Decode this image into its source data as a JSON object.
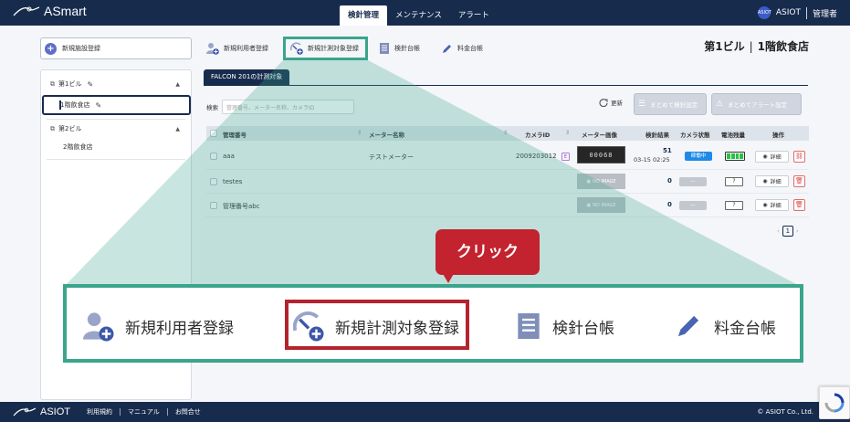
{
  "header": {
    "logo_text": "ASmart",
    "tabs": [
      {
        "label": "検針管理",
        "active": true
      },
      {
        "label": "メンテナンス",
        "active": false
      },
      {
        "label": "アラート",
        "active": false
      }
    ],
    "badge_text": "ASIOT",
    "company": "ASIOT",
    "role": "管理者"
  },
  "sidebar": {
    "new_facility_label": "新規施設登録",
    "tree": [
      {
        "label": "第1ビル",
        "type": "building",
        "expanded": true
      },
      {
        "label": "1階飲食店",
        "type": "floor",
        "selected": true
      },
      {
        "label": "第2ビル",
        "type": "building",
        "expanded": true
      },
      {
        "label": "2階飲食店",
        "type": "floor",
        "selected": false
      }
    ]
  },
  "toolbar": {
    "items": [
      {
        "label": "新規利用者登録",
        "icon": "user-plus-icon"
      },
      {
        "label": "新規計測対象登録",
        "icon": "meter-plus-icon"
      },
      {
        "label": "検針台帳",
        "icon": "ledger-icon"
      },
      {
        "label": "料金台帳",
        "icon": "pencil-icon"
      }
    ],
    "title_building": "第1ビル",
    "title_sep": "|",
    "title_floor": "1階飲食店"
  },
  "main": {
    "tab_label": "FALCON 201の計測対象",
    "search_label": "検索",
    "search_placeholder": "管理番号、メーター名称、カメラID",
    "refresh_label": "更新",
    "bulk_inspection_label": "まとめて検針設定",
    "bulk_alert_label": "まとめてアラート設定"
  },
  "table": {
    "columns": [
      "管理番号",
      "メーター名称",
      "カメラID",
      "メーター画像",
      "検針結果",
      "カメラ状態",
      "電池残量",
      "操作"
    ],
    "rows": [
      {
        "id": "aaa",
        "meter_name": "テストメーター",
        "camera_id": "2009203012",
        "camera_badge": "E",
        "image": "meter",
        "meter_reading": "00068",
        "result": "51",
        "result_date": "03-15 02:25",
        "camera_status": "稼働中",
        "camera_status_active": true,
        "battery": "full",
        "detail_label": "詳細",
        "action_icon": "link-icon"
      },
      {
        "id": "testes",
        "meter_name": "",
        "camera_id": "",
        "camera_badge": "",
        "image": "none",
        "noimage_label": "NO IMAGE",
        "result": "0",
        "result_date": "",
        "camera_status": "—",
        "camera_status_active": false,
        "battery": "unknown",
        "battery_label": "?",
        "detail_label": "詳細",
        "action_icon": "trash-icon"
      },
      {
        "id": "管理番号abc",
        "meter_name": "",
        "camera_id": "",
        "camera_badge": "",
        "image": "none",
        "noimage_label": "NO IMAGE",
        "result": "0",
        "result_date": "",
        "camera_status": "—",
        "camera_status_active": false,
        "battery": "unknown",
        "battery_label": "?",
        "detail_label": "詳細",
        "action_icon": "trash-icon"
      }
    ],
    "pager_current": "1"
  },
  "overlay": {
    "click_label": "クリック",
    "zoom_items": [
      {
        "label": "新規利用者登録",
        "icon": "user-plus-icon"
      },
      {
        "label": "新規計測対象登録",
        "icon": "meter-plus-icon"
      },
      {
        "label": "検針台帳",
        "icon": "ledger-icon"
      },
      {
        "label": "料金台帳",
        "icon": "pencil-icon"
      }
    ]
  },
  "footer": {
    "logo_text": "ASIOT",
    "links": [
      "利用規約",
      "マニュアル",
      "お問合せ"
    ],
    "copyright": "© ASIOT Co., Ltd."
  },
  "colors": {
    "navy": "#172b4d",
    "teal": "#3aa58c",
    "red": "#c2232e",
    "status_active": "#1e8ae8",
    "battery_green": "#29c23f"
  }
}
